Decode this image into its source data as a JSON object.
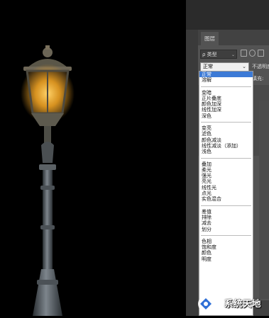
{
  "layers_panel": {
    "tab_title": "图层",
    "filter_label": "ρ 类型",
    "blend_mode_value": "正常",
    "opacity_label": "不透明度:",
    "fill_label": "填充:",
    "caret": "⌄"
  },
  "blend_menu": {
    "groups": [
      [
        "正常",
        "溶解"
      ],
      [
        "变暗",
        "正片叠底",
        "颜色加深",
        "线性加深",
        "深色"
      ],
      [
        "变亮",
        "滤色",
        "颜色减淡",
        "线性减淡（添加）",
        "浅色"
      ],
      [
        "叠加",
        "柔光",
        "强光",
        "亮光",
        "线性光",
        "点光",
        "实色混合"
      ],
      [
        "差值",
        "排除",
        "减去",
        "划分"
      ],
      [
        "色相",
        "饱和度",
        "颜色",
        "明度"
      ]
    ],
    "selected": "正常"
  },
  "watermark": {
    "text": "系统天地"
  },
  "colors": {
    "canvas": "#000000",
    "panel": "#535353",
    "selection": "#3c7ad6",
    "lamp_glow": "#f5a623"
  }
}
